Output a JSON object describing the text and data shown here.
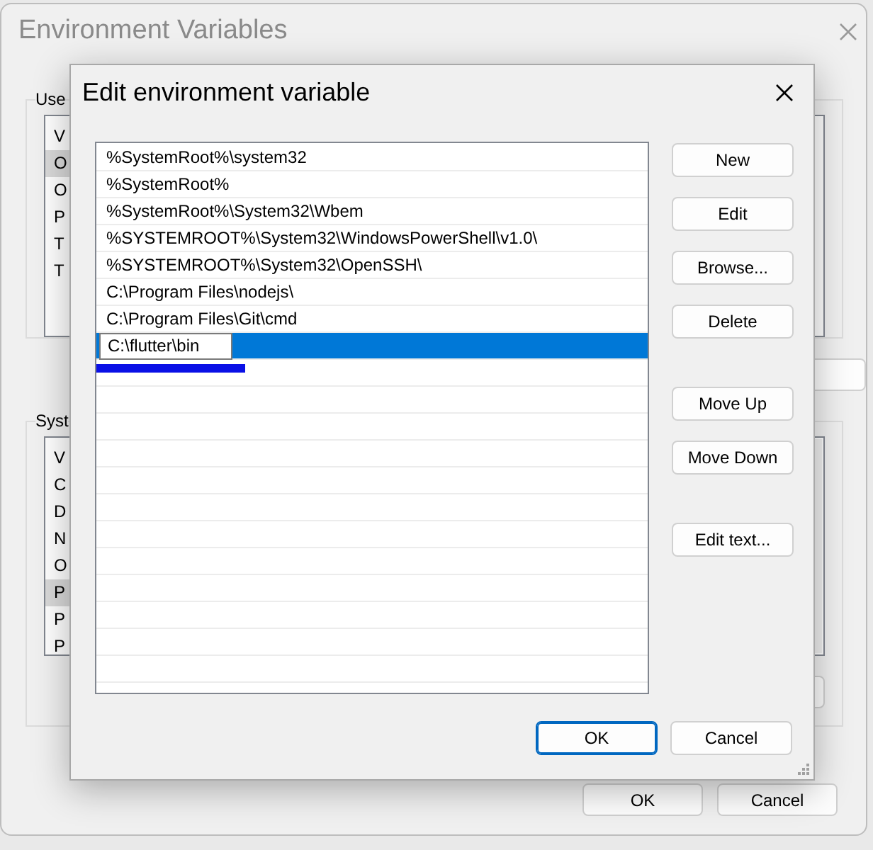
{
  "background_window": {
    "title": "Environment Variables",
    "user_group": {
      "label": "Use",
      "header": "V",
      "rows": [
        {
          "text": "O",
          "selected": true
        },
        {
          "text": "O",
          "selected": false
        },
        {
          "text": "P",
          "selected": false
        },
        {
          "text": "T",
          "selected": false
        },
        {
          "text": "T",
          "selected": false
        }
      ]
    },
    "system_group": {
      "label": "Syst",
      "header": "V",
      "rows": [
        {
          "text": "C",
          "selected": false
        },
        {
          "text": "D",
          "selected": false
        },
        {
          "text": "N",
          "selected": false
        },
        {
          "text": "O",
          "selected": false
        },
        {
          "text": "P",
          "selected": true
        },
        {
          "text": "P",
          "selected": false
        },
        {
          "text": "P",
          "selected": false
        }
      ]
    },
    "buttons": [
      "OK",
      "Cancel"
    ]
  },
  "dialog": {
    "title": "Edit environment variable",
    "entries": [
      {
        "text": "%SystemRoot%\\system32",
        "selected": false,
        "editing": false
      },
      {
        "text": "%SystemRoot%",
        "selected": false,
        "editing": false
      },
      {
        "text": "%SystemRoot%\\System32\\Wbem",
        "selected": false,
        "editing": false
      },
      {
        "text": "%SYSTEMROOT%\\System32\\WindowsPowerShell\\v1.0\\",
        "selected": false,
        "editing": false
      },
      {
        "text": "%SYSTEMROOT%\\System32\\OpenSSH\\",
        "selected": false,
        "editing": false
      },
      {
        "text": "C:\\Program Files\\nodejs\\",
        "selected": false,
        "editing": false
      },
      {
        "text": "C:\\Program Files\\Git\\cmd",
        "selected": false,
        "editing": false
      },
      {
        "text": "C:\\flutter\\bin",
        "selected": true,
        "editing": true
      }
    ],
    "side_button_groups": [
      [
        "New",
        "Edit",
        "Browse...",
        "Delete"
      ],
      [
        "Move Up",
        "Move Down"
      ],
      [
        "Edit text..."
      ]
    ],
    "footer_buttons": [
      {
        "label": "OK",
        "default": true
      },
      {
        "label": "Cancel",
        "default": false
      }
    ]
  }
}
